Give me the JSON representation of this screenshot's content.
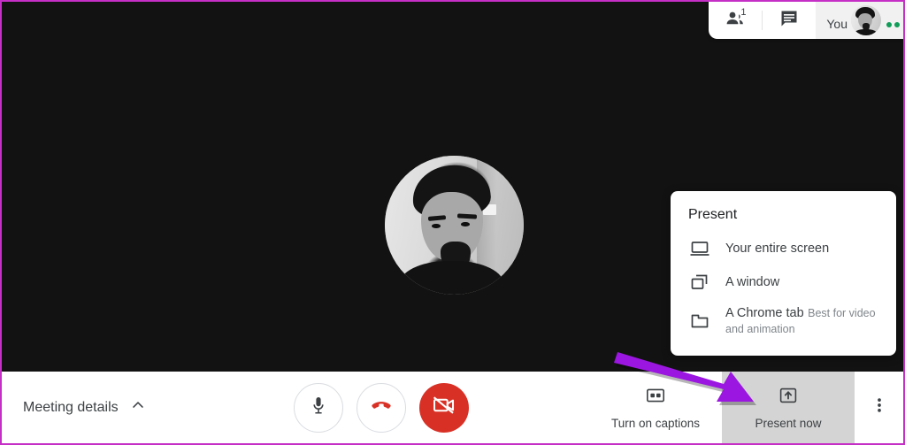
{
  "app": {
    "name": "Google Meet",
    "accent_purple": "#9b16e0",
    "frame_border_color": "#c52fc5",
    "stage_background": "#121212",
    "danger_color": "#d93025",
    "highlight_color": "#d4d4d4"
  },
  "topbar": {
    "people_icon": "people-icon",
    "people_count": "1",
    "chat_icon": "chat-icon",
    "self_label": "You",
    "avatar_icon": "avatar",
    "mic_activity_icon": "mic-activity-dots",
    "mic_activity_color": "#0f9d58"
  },
  "stage": {
    "avatar_icon": "participant-avatar"
  },
  "present_popup": {
    "title": "Present",
    "items": [
      {
        "label": "Your entire screen",
        "sublabel": "",
        "icon": "screen-icon"
      },
      {
        "label": "A window",
        "sublabel": "",
        "icon": "window-icon"
      },
      {
        "label": "A Chrome tab",
        "sublabel": "Best for video and animation",
        "icon": "browser-tab-icon"
      }
    ]
  },
  "bottombar": {
    "meeting_details": {
      "label": "Meeting details",
      "chevron_icon": "chevron-up-icon"
    },
    "controls": [
      {
        "name": "microphone",
        "icon": "microphone-icon",
        "style": "outline"
      },
      {
        "name": "hang-up",
        "icon": "phone-hangup-icon",
        "style": "outline-danger"
      },
      {
        "name": "camera",
        "icon": "camera-off-icon",
        "style": "filled-danger"
      }
    ],
    "captions": {
      "label": "Turn on captions",
      "icon": "closed-captions-icon"
    },
    "present": {
      "label": "Present now",
      "icon": "present-upload-icon",
      "highlighted": true
    },
    "more": {
      "icon": "more-vertical-icon"
    }
  },
  "annotation": {
    "arrow_icon": "pointer-arrow",
    "arrow_color": "#9b16e0",
    "points_at": "Present now"
  }
}
